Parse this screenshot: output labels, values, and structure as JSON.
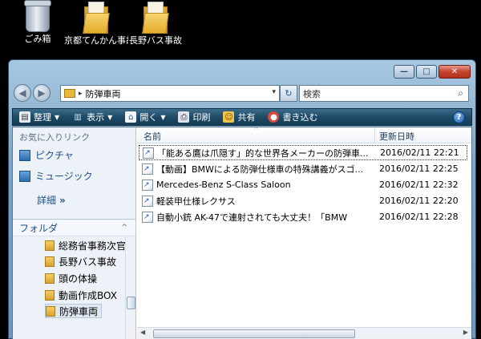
{
  "desktop": {
    "icons": [
      {
        "label": "ごみ箱",
        "icon": "recycle-bin-icon"
      },
      {
        "label": "京都てんかん事故",
        "icon": "folder-icon"
      },
      {
        "label": "長野バス事故",
        "icon": "folder-icon"
      }
    ]
  },
  "window": {
    "controls": {
      "minimize": "—",
      "maximize": "□",
      "close": "✕"
    },
    "nav": {
      "back": "◀",
      "forward": "▶"
    },
    "address": {
      "separator": "▸",
      "path": "防弾車両",
      "dropdown": "▾"
    },
    "refresh": "↻",
    "search": {
      "placeholder": "検索",
      "icon": "search-icon"
    },
    "toolbar": {
      "organize": "整理",
      "views": "表示",
      "open": "開く",
      "print": "印刷",
      "share": "共有",
      "burn": "書き込む",
      "help": "?"
    },
    "navpane": {
      "favorites_header": "お気に入りリンク",
      "favorites": [
        {
          "label": "ピクチャ",
          "icon": "pictures-icon"
        },
        {
          "label": "ミュージック",
          "icon": "music-icon"
        }
      ],
      "details": "詳細",
      "details_chevron": "»",
      "folders_label": "フォルダ",
      "folders_caret": "^",
      "tree": [
        {
          "label": "総務省事務次官"
        },
        {
          "label": "長野バス事故"
        },
        {
          "label": "頭の体操"
        },
        {
          "label": "動画作成BOX"
        },
        {
          "label": "防弾車両",
          "selected": true
        }
      ]
    },
    "filelist": {
      "columns": {
        "name": "名前",
        "modified": "更新日時"
      },
      "sort_indicator": "^",
      "rows": [
        {
          "name": "「能ある鷹は爪隠す」的な世界各メーカーの防弾車...",
          "modified": "2016/02/11 22:21"
        },
        {
          "name": "【動画】BMWによる防弾仕様車の特殊講義がスゴ...",
          "modified": "2016/02/11 22:25"
        },
        {
          "name": "Mercedes-Benz S-Class Saloon",
          "modified": "2016/02/11 22:32"
        },
        {
          "name": "軽装甲仕様レクサス",
          "modified": "2016/02/11 22:20"
        },
        {
          "name": "自動小銃 AK-47で連射されても大丈夫！「BMW",
          "modified": "2016/02/11 22:28"
        }
      ],
      "scroll_left": "◀",
      "scroll_right": "▶"
    }
  }
}
